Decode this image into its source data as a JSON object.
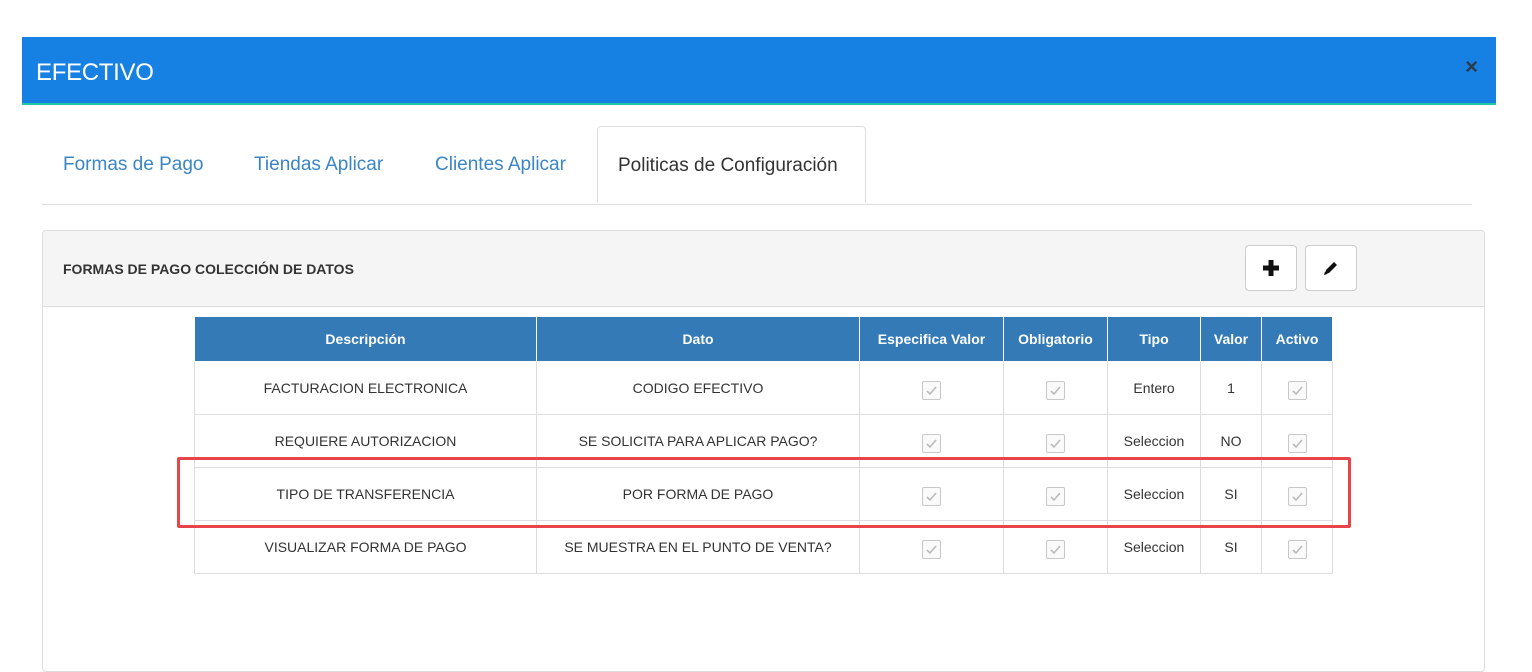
{
  "modal": {
    "title": "EFECTIVO",
    "close_label": "×"
  },
  "tabs": [
    {
      "label": "Formas de Pago"
    },
    {
      "label": "Tiendas Aplicar"
    },
    {
      "label": "Clientes Aplicar"
    },
    {
      "label": "Politicas de Configuración",
      "active": true
    }
  ],
  "panel": {
    "title": "FORMAS DE PAGO COLECCIÓN DE DATOS",
    "add_button_icon": "plus-icon",
    "edit_button_icon": "pencil-icon"
  },
  "table": {
    "headers": [
      "Descripción",
      "Dato",
      "Especifica Valor",
      "Obligatorio",
      "Tipo",
      "Valor",
      "Activo"
    ],
    "rows": [
      {
        "descripcion": "FACTURACION ELECTRONICA",
        "dato": "CODIGO EFECTIVO",
        "especifica_valor": true,
        "obligatorio": true,
        "tipo": "Entero",
        "valor": "1",
        "activo": true
      },
      {
        "descripcion": "REQUIERE AUTORIZACION",
        "dato": "SE SOLICITA PARA APLICAR PAGO?",
        "especifica_valor": true,
        "obligatorio": true,
        "tipo": "Seleccion",
        "valor": "NO",
        "activo": true
      },
      {
        "descripcion": "TIPO DE TRANSFERENCIA",
        "dato": "POR FORMA DE PAGO",
        "especifica_valor": true,
        "obligatorio": true,
        "tipo": "Seleccion",
        "valor": "SI",
        "activo": true
      },
      {
        "descripcion": "VISUALIZAR FORMA DE PAGO",
        "dato": "SE MUESTRA EN EL PUNTO DE VENTA?",
        "especifica_valor": true,
        "obligatorio": true,
        "tipo": "Seleccion",
        "valor": "SI",
        "activo": true
      }
    ]
  },
  "colors": {
    "header_bg": "#1680e3",
    "table_header_bg": "#337ab7",
    "highlight_border": "#e8454a",
    "tab_link": "#3a86c6"
  }
}
